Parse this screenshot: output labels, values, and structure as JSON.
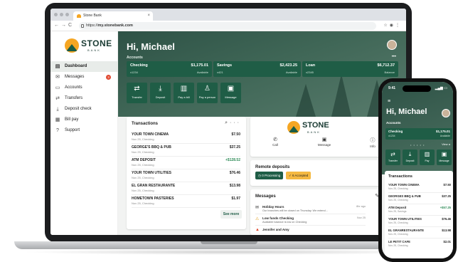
{
  "browser": {
    "tab_title": "Stone Bank",
    "url_prefix": "https://",
    "url_host": "my.stonebank.com"
  },
  "brand": {
    "name": "STONE",
    "sub": "BANK",
    "accent": "#f5a623",
    "primary": "#1f5d46"
  },
  "sidebar": {
    "items": [
      {
        "label": "Dashboard",
        "icon": "dashboard-icon"
      },
      {
        "label": "Messages",
        "icon": "mail-icon",
        "badge": "3"
      },
      {
        "label": "Accounts",
        "icon": "card-icon"
      },
      {
        "label": "Transfers",
        "icon": "transfer-icon"
      },
      {
        "label": "Deposit check",
        "icon": "deposit-icon"
      },
      {
        "label": "Bill pay",
        "icon": "bill-icon"
      },
      {
        "label": "Support",
        "icon": "help-icon"
      }
    ]
  },
  "header": {
    "greeting": "Hi, Michael",
    "accounts_label": "Accounts"
  },
  "accounts": [
    {
      "name": "Checking",
      "amount": "$1,175.01",
      "number": "x1234",
      "status": "Available"
    },
    {
      "name": "Savings",
      "amount": "$2,423.25",
      "number": "x421",
      "status": "Available"
    },
    {
      "name": "Loan",
      "amount": "$6,712.37",
      "number": "x2345",
      "status": "Balance"
    }
  ],
  "quick_actions": [
    {
      "label": "Transfer",
      "icon": "transfer-icon"
    },
    {
      "label": "Deposit",
      "icon": "deposit-icon"
    },
    {
      "label": "Pay a bill",
      "icon": "bill-icon"
    },
    {
      "label": "Pay a person",
      "icon": "person-icon"
    },
    {
      "label": "Message",
      "icon": "message-icon"
    }
  ],
  "transactions": {
    "title": "Transactions",
    "see_more": "See more",
    "rows": [
      {
        "name": "YOUR TOWN CINEMA",
        "date": "Nov 25, Checking",
        "amount": "$7.50",
        "positive": false
      },
      {
        "name": "GEORGE'S BBQ & PUB",
        "date": "Nov 25, Checking",
        "amount": "$37.25",
        "positive": false
      },
      {
        "name": "ATM DEPOSIT",
        "date": "Nov 25, Checking",
        "amount": "+$128.52",
        "positive": true
      },
      {
        "name": "YOUR TOWN UTILITIES",
        "date": "Nov 25, Checking",
        "amount": "$76.46",
        "positive": false
      },
      {
        "name": "EL GRAN RESTAURANTE",
        "date": "Nov 25, Checking",
        "amount": "$13.98",
        "positive": false
      },
      {
        "name": "HOMETOWN PASTERIES",
        "date": "Nov 25, Checking",
        "amount": "$1.97",
        "positive": false
      }
    ]
  },
  "contact": {
    "actions": [
      {
        "label": "Call",
        "icon": "phone-icon"
      },
      {
        "label": "Message",
        "icon": "message-icon"
      },
      {
        "label": "Info",
        "icon": "info-icon"
      }
    ]
  },
  "remote_deposits": {
    "title": "Remote deposits",
    "processing": "0 Processing",
    "accepted": "6 Accepted"
  },
  "messages": {
    "title": "Messages",
    "rows": [
      {
        "title": "Holiday Hours",
        "desc": "Our branches will be closed on Thursday. We extend...",
        "time": "8hr ago",
        "icon": "mail-icon"
      },
      {
        "title": "Low funds Checking",
        "desc": "Available balance is low on Checking",
        "time": "Nov 25",
        "icon": "warning-icon"
      },
      {
        "title": "Jennifer and Amy",
        "desc": "",
        "time": "",
        "icon": "alert-icon"
      }
    ]
  },
  "phone": {
    "time": "9:41",
    "greeting": "Hi, Michael",
    "accounts_label": "Accounts",
    "account": {
      "name": "Checking",
      "number": "x1234",
      "amount": "$1,175.01",
      "status": "Available"
    },
    "view_all": "View a",
    "quick_actions": [
      "Transfer",
      "Deposit",
      "Pay",
      "Message"
    ],
    "transactions_title": "Transactions",
    "rows": [
      {
        "name": "YOUR TOWN CINEMA",
        "date": "Nov 25, Checking",
        "amount": "$7.50",
        "positive": false
      },
      {
        "name": "GEORGES BBQ & PUB",
        "date": "Nov 25, Checking",
        "amount": "$37.25",
        "positive": false
      },
      {
        "name": "ATM Deposit",
        "date": "Nov 25, Savings",
        "amount": "+$57.25",
        "positive": true
      },
      {
        "name": "YOUR TOWN UTILITIES",
        "date": "Nov 25, Checking",
        "amount": "$76.46",
        "positive": false
      },
      {
        "name": "EL GRANRESTAURANTE",
        "date": "Nov 25, Checking",
        "amount": "$13.98",
        "positive": false
      },
      {
        "name": "LE PETIT CAFE",
        "date": "Nov 25, Checking",
        "amount": "$2.01",
        "positive": false
      }
    ]
  }
}
